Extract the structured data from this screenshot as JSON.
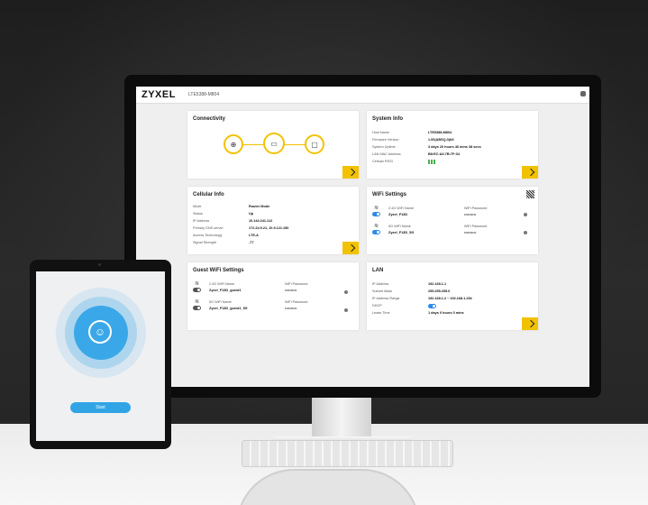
{
  "header": {
    "brand": "ZYXEL",
    "model": "LTE5388-M804"
  },
  "connectivity": {
    "title": "Connectivity",
    "icons": [
      "globe-icon",
      "router-icon",
      "monitor-icon"
    ],
    "accent": "#F2C200"
  },
  "system_info": {
    "title": "System Info",
    "rows": [
      {
        "label": "Host Name",
        "value": "LTE5388-M804"
      },
      {
        "label": "Firmware Version",
        "value": "1.00(ABSQ.0)b5"
      },
      {
        "label": "System Uptime",
        "value": "3 days 20 hours 46 mins 38 secs"
      },
      {
        "label": "LAN MAC Address",
        "value": "B8:EC:A3:7B:7F:34"
      },
      {
        "label": "Cellular RSSI",
        "value": ""
      }
    ]
  },
  "cellular_info": {
    "title": "Cellular Info",
    "rows": [
      {
        "label": "Mode",
        "value": "Router Mode"
      },
      {
        "label": "Status",
        "value": "Up"
      },
      {
        "label": "IP Address",
        "value": "10.144.241.112"
      },
      {
        "label": "Primary DNS server",
        "value": "172.24.9.21, 10.9.121.150"
      },
      {
        "label": "Access Technology",
        "value": "LTE-A"
      },
      {
        "label": "Signal Strength",
        "value": "-77"
      }
    ]
  },
  "wifi_settings": {
    "title": "WiFi Settings",
    "col_name": "WiFi Name",
    "col_password": "WiFi Password",
    "rows": [
      {
        "band": "2.4G WiFi Name",
        "ssid": "Zyxel_F13D",
        "password": "••••••••••"
      },
      {
        "band": "5G WiFi Name",
        "ssid": "Zyxel_F13D_5G",
        "password": "••••••••••"
      }
    ]
  },
  "guest_wifi": {
    "title": "Guest WiFi Settings",
    "col_password": "WiFi Password",
    "rows": [
      {
        "band": "2.4G WiFi Name",
        "ssid": "Zyxel_F13D_guest1",
        "password": "••••••••••"
      },
      {
        "band": "5G WiFi Name",
        "ssid": "Zyxel_F13D_guest1_5G",
        "password": "••••••••••"
      }
    ]
  },
  "lan": {
    "title": "LAN",
    "rows": [
      {
        "label": "IP Address",
        "value": "192.168.1.1"
      },
      {
        "label": "Subnet Mask",
        "value": "255.255.255.0"
      },
      {
        "label": "IP Address Range",
        "value": "192.168.1.2 ~ 192.168.1.254"
      },
      {
        "label": "DHCP",
        "value": ""
      },
      {
        "label": "Lease Time",
        "value": "1 days 0 hours 0 mins"
      }
    ]
  },
  "tablet": {
    "start_label": "Start",
    "accent": "#31A4E6"
  }
}
